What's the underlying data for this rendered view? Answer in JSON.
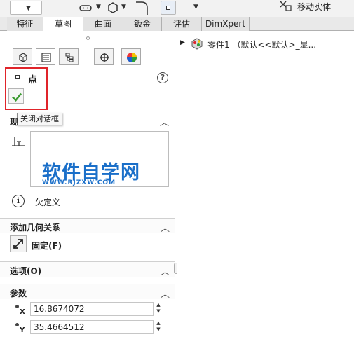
{
  "toolbar": {
    "move_entity_label": "移动实体",
    "icons": [
      "dropdown-box",
      "link-icon",
      "polygon-icon",
      "fillet-icon",
      "point-icon",
      "move-entity-icon"
    ]
  },
  "tabs": [
    {
      "label": "特征"
    },
    {
      "label": "草图",
      "active": true
    },
    {
      "label": "曲面"
    },
    {
      "label": "钣金"
    },
    {
      "label": "评估"
    },
    {
      "label": "DimXpert"
    }
  ],
  "panel": {
    "tab_icons": [
      "feature-manager-icon",
      "property-manager-icon",
      "configuration-manager-icon",
      "dimxpert-manager-icon",
      "display-manager-icon"
    ],
    "title": "点",
    "tooltip": "关闭对话框",
    "existing_relations_label": "现",
    "watermark": {
      "main": "软件自学网",
      "url": "WWW.RJZXW.COM"
    },
    "status": "欠定义",
    "add_relations": {
      "title": "添加几何关系",
      "fix_label": "固定(F)"
    },
    "options": {
      "title": "选项(O)"
    },
    "params": {
      "title": "参数",
      "x_value": "16.8674072",
      "y_value": "35.4664512",
      "x_sub": "X",
      "y_sub": "Y"
    }
  },
  "tree": {
    "root_label": "零件1 （默认<<默认>_显..."
  },
  "colors": {
    "accent_blue": "#1a6fc9",
    "highlight_red": "#e0242a",
    "check_green": "#3a9a2f"
  }
}
